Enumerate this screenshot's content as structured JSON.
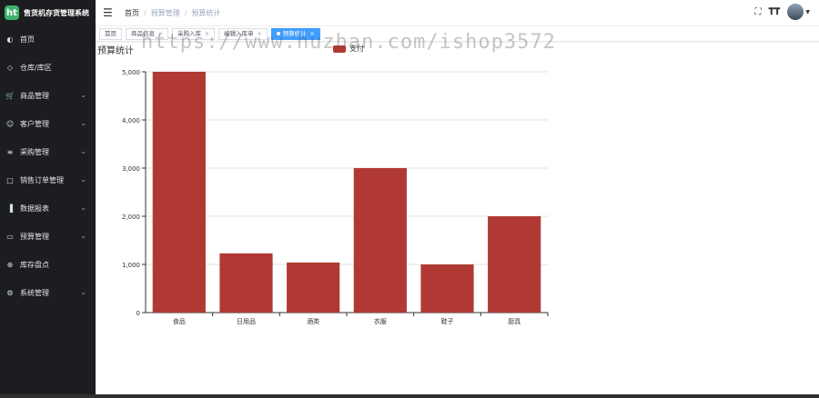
{
  "app": {
    "title": "售货机存货管理系统",
    "logo_text": "ht"
  },
  "sidebar": {
    "items": [
      {
        "label": "首页",
        "icon": "dashboard-icon",
        "has_arrow": false
      },
      {
        "label": "仓库/库区",
        "icon": "warehouse-icon",
        "has_arrow": false
      },
      {
        "label": "商品管理",
        "icon": "cart-icon",
        "has_arrow": true
      },
      {
        "label": "客户管理",
        "icon": "users-icon",
        "has_arrow": true
      },
      {
        "label": "采购管理",
        "icon": "stack-icon",
        "has_arrow": true
      },
      {
        "label": "销售订单管理",
        "icon": "book-icon",
        "has_arrow": true
      },
      {
        "label": "数据报表",
        "icon": "bar-chart-icon",
        "has_arrow": true
      },
      {
        "label": "预算管理",
        "icon": "wallet-icon",
        "has_arrow": true
      },
      {
        "label": "库存盘点",
        "icon": "circle-plus-icon",
        "has_arrow": false
      },
      {
        "label": "系统管理",
        "icon": "gear-icon",
        "has_arrow": true
      }
    ]
  },
  "header": {
    "breadcrumb": [
      "首页",
      "预算管理",
      "预算统计"
    ]
  },
  "tags": [
    {
      "label": "首页",
      "active": false,
      "closable": false
    },
    {
      "label": "商品信息",
      "active": false,
      "closable": true
    },
    {
      "label": "采购入库",
      "active": false,
      "closable": true
    },
    {
      "label": "编辑入库单",
      "active": false,
      "closable": true
    },
    {
      "label": "预算统计",
      "active": true,
      "closable": true
    }
  ],
  "watermark": "https://www.huzhan.com/ishop3572",
  "chart_data": {
    "type": "bar",
    "title": "预算统计",
    "categories": [
      "食品",
      "日用品",
      "酒类",
      "衣服",
      "鞋子",
      "厨具"
    ],
    "series": [
      {
        "name": "支付",
        "values": [
          5000,
          1230,
          1040,
          3000,
          1000,
          2000
        ]
      }
    ],
    "ylim": [
      0,
      5000
    ],
    "yticks": [
      "0",
      "1,000",
      "2,000",
      "3,000",
      "4,000",
      "5,000"
    ],
    "grid": true,
    "legend": "top-center",
    "color": "#b03a33"
  }
}
